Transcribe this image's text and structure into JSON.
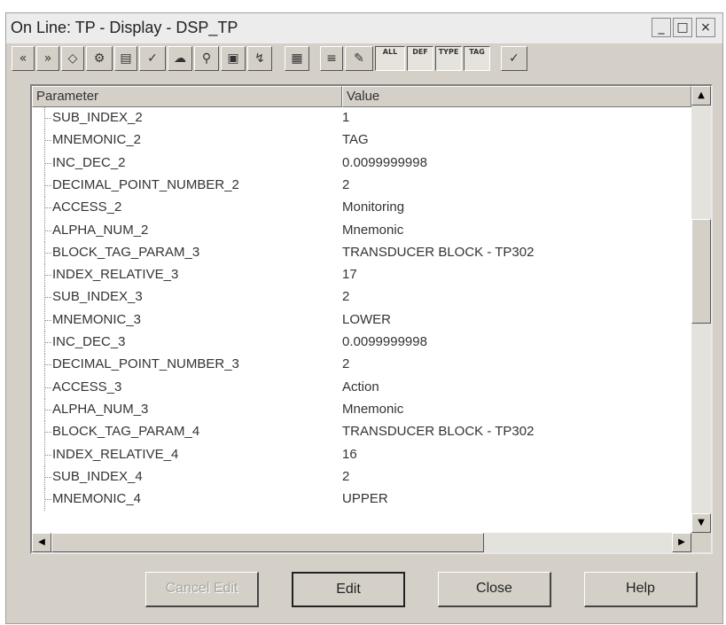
{
  "window": {
    "title": "On Line: TP - Display - DSP_TP",
    "minimize_label": "_",
    "maximize_label": "□",
    "close_label": "×"
  },
  "toolbar": {
    "buttons": [
      {
        "name": "prev-icon",
        "glyph": "«"
      },
      {
        "name": "next-icon",
        "glyph": "»"
      },
      {
        "name": "diamond-icon",
        "glyph": "◇"
      },
      {
        "name": "gear-icon",
        "glyph": "⚙"
      },
      {
        "name": "block-icon",
        "glyph": "▤"
      },
      {
        "name": "check-edit-icon",
        "glyph": "✓"
      },
      {
        "name": "cloud-icon",
        "glyph": "☁"
      },
      {
        "name": "probe-icon",
        "glyph": "⚲"
      },
      {
        "name": "panel-icon",
        "glyph": "▣"
      },
      {
        "name": "trend-icon",
        "glyph": "↯"
      },
      {
        "name": "param-icon",
        "glyph": "▦"
      },
      {
        "name": "list-icon",
        "glyph": "≡"
      },
      {
        "name": "write-icon",
        "glyph": "✎"
      },
      {
        "name": "all-icon",
        "glyph": "ALL"
      },
      {
        "name": "def-icon",
        "glyph": "DEF"
      },
      {
        "name": "type-icon",
        "glyph": "TYPE"
      },
      {
        "name": "tag-icon",
        "glyph": "TAG"
      },
      {
        "name": "apply-check-icon",
        "glyph": "✓"
      }
    ]
  },
  "grid": {
    "col_parameter": "Parameter",
    "col_value": "Value",
    "rows": [
      {
        "param": "SUB_INDEX_2",
        "value": "1"
      },
      {
        "param": "MNEMONIC_2",
        "value": "TAG"
      },
      {
        "param": "INC_DEC_2",
        "value": "0.0099999998"
      },
      {
        "param": "DECIMAL_POINT_NUMBER_2",
        "value": "2"
      },
      {
        "param": "ACCESS_2",
        "value": "Monitoring"
      },
      {
        "param": "ALPHA_NUM_2",
        "value": "Mnemonic"
      },
      {
        "param": "BLOCK_TAG_PARAM_3",
        "value": "TRANSDUCER BLOCK - TP302"
      },
      {
        "param": "INDEX_RELATIVE_3",
        "value": "17"
      },
      {
        "param": "SUB_INDEX_3",
        "value": "2"
      },
      {
        "param": "MNEMONIC_3",
        "value": "LOWER"
      },
      {
        "param": "INC_DEC_3",
        "value": "0.0099999998"
      },
      {
        "param": "DECIMAL_POINT_NUMBER_3",
        "value": "2"
      },
      {
        "param": "ACCESS_3",
        "value": "Action"
      },
      {
        "param": "ALPHA_NUM_3",
        "value": "Mnemonic"
      },
      {
        "param": "BLOCK_TAG_PARAM_4",
        "value": "TRANSDUCER BLOCK - TP302"
      },
      {
        "param": "INDEX_RELATIVE_4",
        "value": "16"
      },
      {
        "param": "SUB_INDEX_4",
        "value": "2"
      },
      {
        "param": "MNEMONIC_4",
        "value": "UPPER"
      }
    ]
  },
  "scroll": {
    "up": "▲",
    "down": "▼",
    "left": "◀",
    "right": "▶"
  },
  "buttons": {
    "cancel_edit": "Cancel Edit",
    "edit": "Edit",
    "close": "Close",
    "help": "Help"
  }
}
